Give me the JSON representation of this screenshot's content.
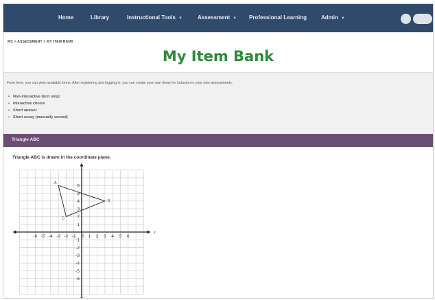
{
  "nav": {
    "items": [
      {
        "label": "Home",
        "dropdown": false
      },
      {
        "label": "Library",
        "dropdown": false
      },
      {
        "label": "Instructional Tools",
        "dropdown": true
      },
      {
        "label": "Assessment",
        "dropdown": true
      },
      {
        "label": "Professional Learning",
        "dropdown": false
      },
      {
        "label": "Admin",
        "dropdown": true
      }
    ],
    "background": "#2f4a6b"
  },
  "breadcrumb": "MC > ASSESSMENT > MY ITEM BANK",
  "page_title": "My Item Bank",
  "intro": {
    "text": "From here, you can view available items. After registering and logging in, you can create your own items for inclusion in your own assessments.",
    "item_types": [
      "Non-interactive (text only)",
      "Interactive choice",
      "Short answer",
      "Short essay (manually scored)"
    ]
  },
  "item": {
    "title": "Triangle ABC",
    "question": "Triangle ABC is drawn in the coordinate plane.",
    "accent_color": "#6b4e73"
  },
  "plane": {
    "x_labels": [
      "-6",
      "-5",
      "-4",
      "-3",
      "-2",
      "-1",
      "0",
      "1",
      "2",
      "3",
      "4",
      "5",
      "6"
    ],
    "y_labels": [
      "6",
      "5",
      "4",
      "3",
      "2",
      "1",
      "-1",
      "-2",
      "-3",
      "-4",
      "-5",
      "-6"
    ],
    "x_axis_label": "x",
    "y_axis_label": "y",
    "triangle": {
      "vertices": [
        {
          "name": "A",
          "x": -3,
          "y": 6
        },
        {
          "name": "B",
          "x": 3,
          "y": 4
        },
        {
          "name": "C",
          "x": -2,
          "y": 2
        }
      ]
    }
  }
}
